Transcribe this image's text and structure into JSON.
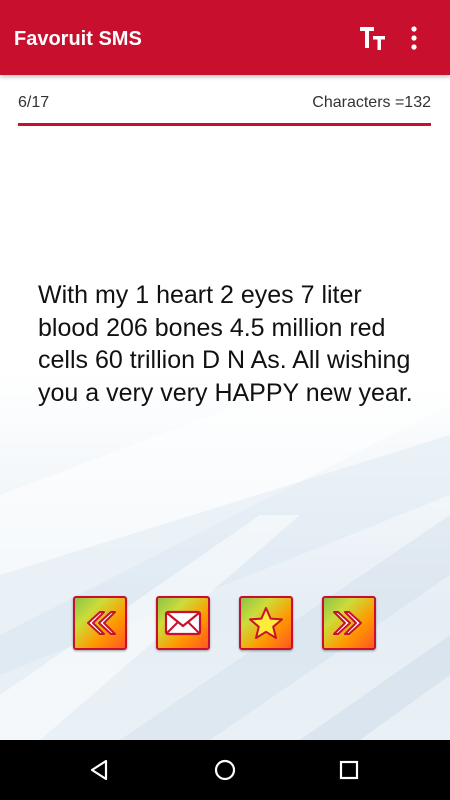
{
  "app": {
    "title": "Favoruit SMS",
    "accent_color": "#c8102e"
  },
  "toolbar": {
    "text_size_icon": "text-size-icon",
    "overflow_icon": "overflow-menu-icon"
  },
  "counter": {
    "position": "6/17",
    "characters": "Characters =132"
  },
  "message": {
    "text": "With my 1 heart 2 eyes 7 liter blood 206 bones 4.5 million red cells 60 trillion D N As. All wishing you a very very HAPPY new year."
  },
  "actions": [
    {
      "icon": "previous-double-chevron-icon"
    },
    {
      "icon": "envelope-icon"
    },
    {
      "icon": "star-icon"
    },
    {
      "icon": "next-double-chevron-icon"
    }
  ],
  "navbar": {
    "back_icon": "back-triangle-icon",
    "home_icon": "home-circle-icon",
    "recent_icon": "recent-apps-square-icon"
  }
}
